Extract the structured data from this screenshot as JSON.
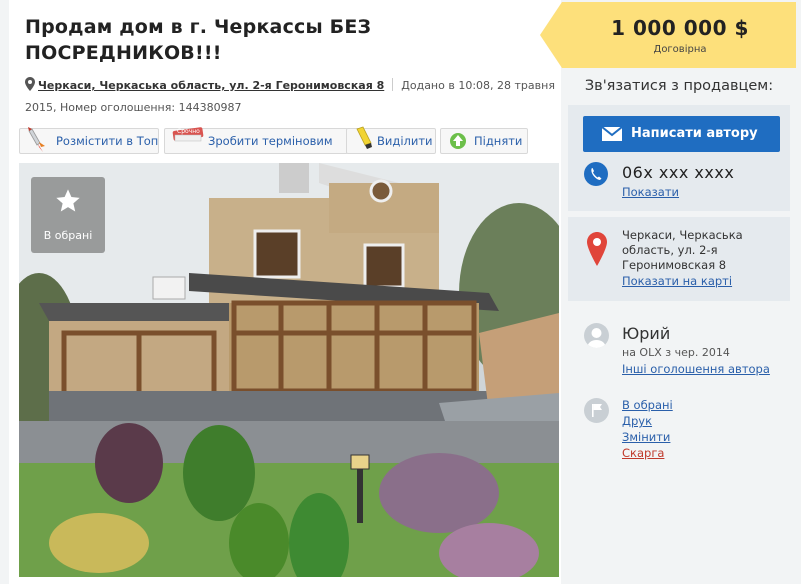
{
  "ad": {
    "title": "Продам дом в г. Черкассы БЕЗ ПОСРЕДНИКОВ!!!",
    "location": "Черкаси, Черкаська область, ул. 2-я Геронимовская 8",
    "added": "Додано в 10:08, 28 травня 2015, Номер оголошення: 144380987"
  },
  "actions": [
    {
      "label": "Розмістити в Топ"
    },
    {
      "label": "Зробити терміновим",
      "badge": "Срочно"
    },
    {
      "label": "Виділити"
    },
    {
      "label": "Підняти"
    }
  ],
  "photo": {
    "favorite_label": "В обрані"
  },
  "price": {
    "value": "1 000 000 $",
    "note": "Договірна"
  },
  "contact": {
    "title": "Зв'язатися з продавцем:",
    "write_label": "Написати автору",
    "phone": "06x xxx xxxx",
    "phone_show": "Показати",
    "address": "Черкаси, Черкаська область, ул. 2-я Геронимовская 8",
    "map_link": "Показати на карті"
  },
  "seller": {
    "name": "Юрий",
    "since": "на OLX з чер. 2014",
    "other_ads": "Інші оголошення автора"
  },
  "tools": [
    {
      "label": "В обрані",
      "color": "#2a5faa"
    },
    {
      "label": "Друк",
      "color": "#2a5faa"
    },
    {
      "label": "Змінити",
      "color": "#2a5faa"
    },
    {
      "label": "Скарга",
      "color": "#c0392b"
    }
  ],
  "colors": {
    "price_tag": "#fde07b",
    "button": "#1f6dc1",
    "panel": "#e5eaee"
  }
}
